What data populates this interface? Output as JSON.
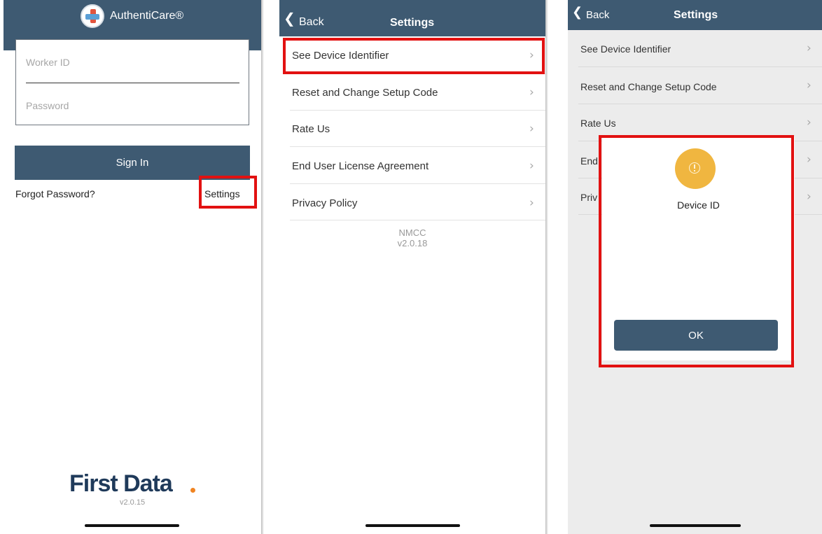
{
  "screen1": {
    "app_title": "AuthentiCare®",
    "worker_id_placeholder": "Worker ID",
    "password_placeholder": "Password",
    "sign_in_label": "Sign In",
    "forgot_password_label": "Forgot Password?",
    "settings_label": "Settings",
    "brand_name": "First Data",
    "version": "v2.0.15"
  },
  "screen2": {
    "back_label": "Back",
    "title": "Settings",
    "items": [
      {
        "label": "See Device Identifier"
      },
      {
        "label": "Reset and Change Setup Code"
      },
      {
        "label": "Rate Us"
      },
      {
        "label": "End User License Agreement"
      },
      {
        "label": "Privacy Policy"
      }
    ],
    "app_name": "NMCC",
    "version": "v2.0.18"
  },
  "screen3": {
    "back_label": "Back",
    "title": "Settings",
    "items": [
      {
        "label": "See Device Identifier"
      },
      {
        "label": "Reset and Change Setup Code"
      },
      {
        "label": "Rate Us"
      },
      {
        "label": "End"
      },
      {
        "label": "Priv"
      }
    ],
    "dialog": {
      "icon": "warning-icon",
      "message": "Device ID",
      "ok_label": "OK"
    }
  },
  "colors": {
    "header": "#3e5a72",
    "highlight": "#e21111",
    "warning": "#f0b640",
    "brand_accent": "#f08422"
  }
}
